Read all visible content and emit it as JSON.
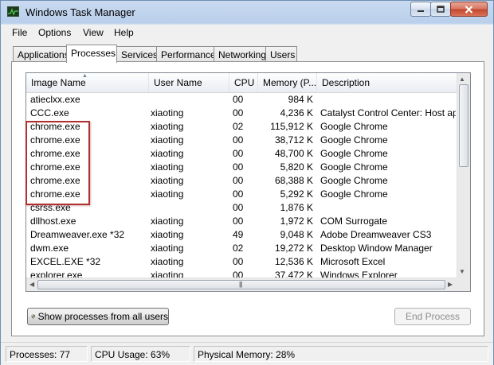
{
  "window": {
    "title": "Windows Task Manager"
  },
  "menu": [
    "File",
    "Options",
    "View",
    "Help"
  ],
  "tabs": [
    "Applications",
    "Processes",
    "Services",
    "Performance",
    "Networking",
    "Users"
  ],
  "active_tab": "Processes",
  "columns": [
    "Image Name",
    "User Name",
    "CPU",
    "Memory (P...",
    "Description"
  ],
  "rows": [
    {
      "name": "atieclxx.exe",
      "user": "",
      "cpu": "00",
      "mem": "984 K",
      "desc": ""
    },
    {
      "name": "CCC.exe",
      "user": "xiaoting",
      "cpu": "00",
      "mem": "4,236 K",
      "desc": "Catalyst Control Center: Host appli"
    },
    {
      "name": "chrome.exe",
      "user": "xiaoting",
      "cpu": "02",
      "mem": "115,912 K",
      "desc": "Google Chrome"
    },
    {
      "name": "chrome.exe",
      "user": "xiaoting",
      "cpu": "00",
      "mem": "38,712 K",
      "desc": "Google Chrome"
    },
    {
      "name": "chrome.exe",
      "user": "xiaoting",
      "cpu": "00",
      "mem": "48,700 K",
      "desc": "Google Chrome"
    },
    {
      "name": "chrome.exe",
      "user": "xiaoting",
      "cpu": "00",
      "mem": "5,820 K",
      "desc": "Google Chrome"
    },
    {
      "name": "chrome.exe",
      "user": "xiaoting",
      "cpu": "00",
      "mem": "68,388 K",
      "desc": "Google Chrome"
    },
    {
      "name": "chrome.exe",
      "user": "xiaoting",
      "cpu": "00",
      "mem": "5,292 K",
      "desc": "Google Chrome"
    },
    {
      "name": "csrss.exe",
      "user": "",
      "cpu": "00",
      "mem": "1,876 K",
      "desc": ""
    },
    {
      "name": "dllhost.exe",
      "user": "xiaoting",
      "cpu": "00",
      "mem": "1,972 K",
      "desc": "COM Surrogate"
    },
    {
      "name": "Dreamweaver.exe *32",
      "user": "xiaoting",
      "cpu": "49",
      "mem": "9,048 K",
      "desc": "Adobe Dreamweaver CS3"
    },
    {
      "name": "dwm.exe",
      "user": "xiaoting",
      "cpu": "02",
      "mem": "19,272 K",
      "desc": "Desktop Window Manager"
    },
    {
      "name": "EXCEL.EXE *32",
      "user": "xiaoting",
      "cpu": "00",
      "mem": "12,536 K",
      "desc": "Microsoft Excel"
    },
    {
      "name": "explorer.exe",
      "user": "xiaoting",
      "cpu": "00",
      "mem": "37,472 K",
      "desc": "Windows Explorer"
    }
  ],
  "buttons": {
    "show_all": "Show processes from all users",
    "end_process": "End Process"
  },
  "status": {
    "processes": "Processes: 77",
    "cpu": "CPU Usage: 63%",
    "memory": "Physical Memory: 28%"
  },
  "colors": {
    "highlight_box": "#b03030",
    "title_gradient": "#b9cfeb",
    "close_button": "#c4452c"
  }
}
